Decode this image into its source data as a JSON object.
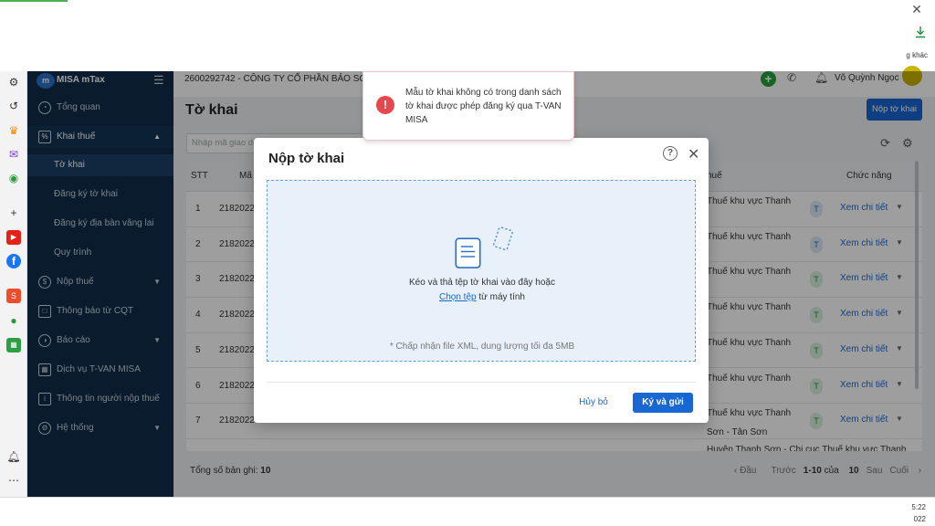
{
  "browser": {
    "close_glyph": "✕",
    "download_icon": "download-icon",
    "other_text": "g khác"
  },
  "app": {
    "name": "MISA mTax",
    "company": "2600292742 - CÔNG TY CỔ PHẦN BẢO SƠ",
    "username": "Võ Quỳnh Ngọc"
  },
  "sidebar": {
    "items": [
      {
        "label": "Tổng quan",
        "icon": "dashboard-icon"
      },
      {
        "label": "Khai thuế",
        "icon": "declaration-icon",
        "expanded": true
      },
      {
        "label": "Tờ khai",
        "sub": true,
        "active": true
      },
      {
        "label": "Đăng ký tờ khai",
        "sub": true
      },
      {
        "label": "Đăng ký địa bàn vãng lai",
        "sub": true
      },
      {
        "label": "Quy trình",
        "sub": true
      },
      {
        "label": "Nộp thuế",
        "icon": "dollar-icon"
      },
      {
        "label": "Thông báo từ CQT",
        "icon": "notice-icon"
      },
      {
        "label": "Báo cáo",
        "icon": "report-icon"
      },
      {
        "label": "Dịch vụ T-VAN MISA",
        "icon": "service-icon"
      },
      {
        "label": "Thông tin người nộp thuế",
        "icon": "info-icon"
      },
      {
        "label": "Hệ thống",
        "icon": "gear-icon"
      }
    ]
  },
  "main": {
    "title": "Tờ khai",
    "submit_button": "Nộp tờ khai",
    "filter_placeholder": "Nhập mã giao dị",
    "table": {
      "headers": {
        "stt": "STT",
        "code": "Mã",
        "tax_office": "huế",
        "actions": "Chức năng"
      },
      "rows": [
        {
          "stt": "1",
          "code": "2182022",
          "office": "Thuế khu vực Thanh",
          "tag": "T",
          "action": "Xem chi tiết",
          "tag_color": "blue"
        },
        {
          "stt": "2",
          "code": "2182022",
          "office": "Thuế khu vực Thanh",
          "tag": "T",
          "action": "Xem chi tiết",
          "tag_color": "blue"
        },
        {
          "stt": "3",
          "code": "2182022",
          "office": "Thuế khu vực Thanh",
          "tag": "T",
          "action": "Xem chi tiết",
          "tag_color": "green"
        },
        {
          "stt": "4",
          "code": "2182022",
          "office": "Thuế khu vực Thanh",
          "tag": "T",
          "action": "Xem chi tiết",
          "tag_color": "green"
        },
        {
          "stt": "5",
          "code": "2182022",
          "office": "Thuế khu vực Thanh",
          "tag": "T",
          "action": "Xem chi tiết",
          "tag_color": "green"
        },
        {
          "stt": "6",
          "code": "2182022",
          "office": "Thuế khu vực Thanh",
          "tag": "T",
          "action": "Xem chi tiết",
          "tag_color": "green"
        },
        {
          "stt": "7",
          "code": "2182022",
          "office": "Thuế khu vực Thanh",
          "tag": "T",
          "action": "Xem chi tiết",
          "tag_color": "green"
        }
      ],
      "partial_row_office": "Huyện Thanh Sơn - Chi cục Thuế khu vực Thanh",
      "partial_row_extra": "Sơn - Tân Sơn"
    },
    "footer": {
      "total_label": "Tổng số bản ghi:",
      "total_value": "10",
      "pager": {
        "first": "Đầu",
        "prev": "Trước",
        "range": "1-10",
        "of_label": "của",
        "total": "10",
        "next": "Sau",
        "last": "Cuối"
      }
    }
  },
  "modal": {
    "title": "Nộp tờ khai",
    "drop_text": "Kéo và thả tệp tờ khai vào đây hoặc",
    "choose_link": "Chọn tệp",
    "from_computer": "từ máy tính",
    "accept_text": "* Chấp nhận file XML, dung lượng tối đa 5MB",
    "cancel": "Hủy bỏ",
    "sign_send": "Ký và gửi"
  },
  "toast": {
    "message": "Mẫu tờ khai không có trong danh sách tờ khai được phép đăng ký qua T-VAN MISA",
    "type": "error"
  },
  "taskbar": {
    "time": "5:22",
    "date": "022"
  },
  "colors": {
    "primary": "#1967d2",
    "sidebar_bg": "#0f2c4a",
    "error": "#e5484d",
    "success": "#22a33a"
  }
}
